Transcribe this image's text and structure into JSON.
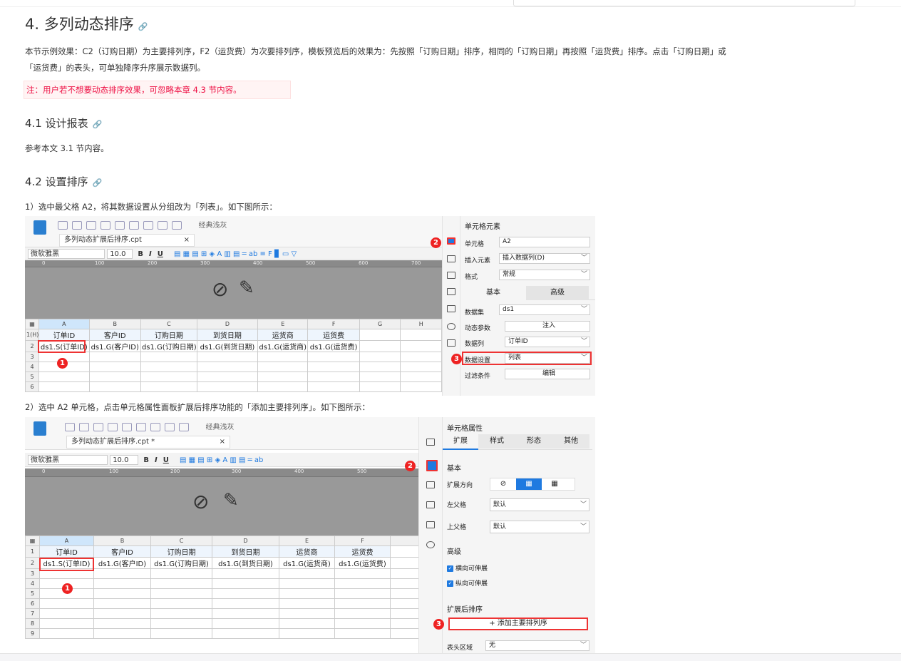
{
  "heading4": "4. 多列动态排序",
  "link_icon": "🔗",
  "intro1": "本节示例效果：C2（订购日期）为主要排列序，F2（运货费）为次要排列序，模板预览后的效果为：先按照「订购日期」排序，相同的「订购日期」再按照「运货费」排序。点击「订购日期」或",
  "intro2": "「运货费」的表头，可单独降序升序展示数据列。",
  "note": "注：用户若不想要动态排序效果，可忽略本章 4.3 节内容。",
  "h41": "4.1 设计报表",
  "p41": "参考本文 3.1 节内容。",
  "h42": "4.2 设置排序",
  "step1": "1）选中最父格 A2，将其数据设置从分组改为「列表」。如下图所示：",
  "step2": "2）选中 A2 单元格，点击单元格属性面板扩展后排序功能的「添加主要排列序」。如下图所示：",
  "shot1": {
    "theme": "经典浅灰",
    "file_tab": "多列动态扩展后排序.cpt",
    "font": "微软雅黑",
    "size": "10.0",
    "cols": [
      "A",
      "B",
      "C",
      "D",
      "E",
      "F",
      "G",
      "H"
    ],
    "rows": [
      [
        "1(H)",
        "订单ID",
        "客户ID",
        "订购日期",
        "到货日期",
        "运货商",
        "运货费",
        "",
        ""
      ],
      [
        "2",
        "ds1.S(订单ID)",
        "ds1.G(客户ID)",
        "ds1.G(订购日期)",
        "ds1.G(到货日期)",
        "ds1.G(运货商)",
        "ds1.G(运货费)",
        "",
        ""
      ],
      [
        "3",
        "",
        "",
        "",
        "",
        "",
        "",
        "",
        ""
      ],
      [
        "4",
        "",
        "",
        "",
        "",
        "",
        "",
        "",
        ""
      ],
      [
        "5",
        "",
        "",
        "",
        "",
        "",
        "",
        "",
        ""
      ],
      [
        "6",
        "",
        "",
        "",
        "",
        "",
        "",
        "",
        ""
      ]
    ],
    "ruler": [
      "0",
      "100",
      "200",
      "300",
      "400",
      "500",
      "600",
      "700"
    ],
    "panel": {
      "title": "单元格元素",
      "cell_label": "单元格",
      "cell_value": "A2",
      "insert_label": "插入元素",
      "insert_value": "插入数据列(D)",
      "format_label": "格式",
      "format_value": "常规",
      "tab_basic": "基本",
      "tab_adv": "高级",
      "ds_label": "数据集",
      "ds_value": "ds1",
      "dyn_label": "动态参数",
      "dyn_btn": "注入",
      "col_label": "数据列",
      "col_value": "订单ID",
      "set_label": "数据设置",
      "set_value": "列表",
      "filter_label": "过滤条件",
      "filter_btn": "编辑"
    }
  },
  "shot2": {
    "theme": "经典浅灰",
    "file_tab": "多列动态扩展后排序.cpt *",
    "font": "微软雅黑",
    "size": "10.0",
    "cols": [
      "A",
      "B",
      "C",
      "D",
      "E",
      "F"
    ],
    "rows": [
      [
        "1",
        "订单ID",
        "客户ID",
        "订购日期",
        "到货日期",
        "运货商",
        "运货费"
      ],
      [
        "2",
        "ds1.S(订单ID)",
        "ds1.G(客户ID)",
        "ds1.G(订购日期)",
        "ds1.G(到货日期)",
        "ds1.G(运货商)",
        "ds1.G(运货费)"
      ],
      [
        "3",
        "",
        "",
        "",
        "",
        "",
        ""
      ],
      [
        "4",
        "",
        "",
        "",
        "",
        "",
        ""
      ],
      [
        "5",
        "",
        "",
        "",
        "",
        "",
        ""
      ],
      [
        "6",
        "",
        "",
        "",
        "",
        "",
        ""
      ],
      [
        "7",
        "",
        "",
        "",
        "",
        "",
        ""
      ],
      [
        "8",
        "",
        "",
        "",
        "",
        "",
        ""
      ],
      [
        "9",
        "",
        "",
        "",
        "",
        "",
        ""
      ]
    ],
    "ruler": [
      "0",
      "100",
      "200",
      "300",
      "400",
      "500"
    ],
    "panel": {
      "title": "单元格属性",
      "tabs": [
        "扩展",
        "样式",
        "形态",
        "其他"
      ],
      "basic": "基本",
      "dir_label": "扩展方向",
      "left_label": "左父格",
      "left_value": "默认",
      "up_label": "上父格",
      "up_value": "默认",
      "adv": "高级",
      "chk1": "横向可伸展",
      "chk2": "纵向可伸展",
      "sort_section": "扩展后排序",
      "add_btn": "+ 添加主要排列序",
      "header_label": "表头区域",
      "header_value": "无"
    }
  },
  "badges": [
    "1",
    "2",
    "3"
  ]
}
